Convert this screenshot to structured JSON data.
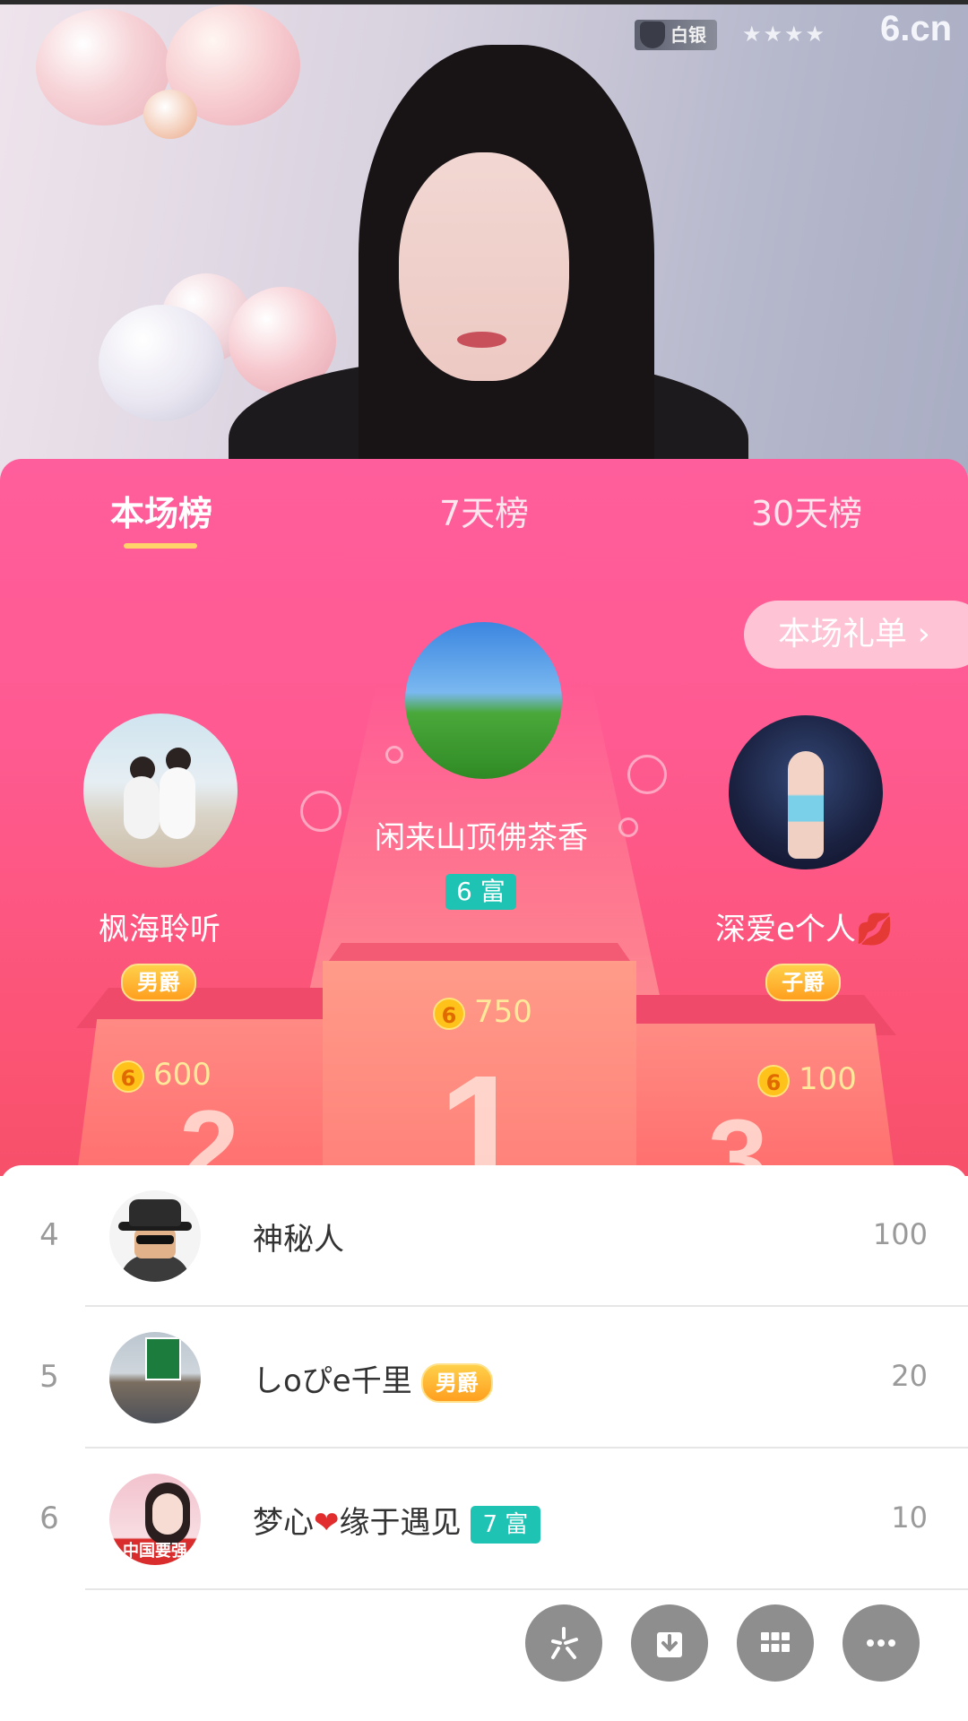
{
  "video": {
    "level_badge": "白银",
    "stars": "★★★★",
    "site_logo": "6.cn"
  },
  "tabs": [
    {
      "label": "本场榜",
      "active": true
    },
    {
      "label": "7天榜",
      "active": false
    },
    {
      "label": "30天榜",
      "active": false
    }
  ],
  "gift_list_button": "本场礼单 ›",
  "podium": {
    "first": {
      "name": "闲来山顶佛茶香",
      "badge": "6 富",
      "coin_icon": "6",
      "amount": "750"
    },
    "second": {
      "name": "枫海聆听",
      "badge": "男爵",
      "coin_icon": "6",
      "amount": "600",
      "podium_number": "2"
    },
    "third": {
      "name": "深爱e个人💋",
      "badge": "子爵",
      "coin_icon": "6",
      "amount": "100",
      "podium_number": "3"
    },
    "center_number": "1"
  },
  "list": [
    {
      "rank": "4",
      "name": "神秘人",
      "score": "100"
    },
    {
      "rank": "5",
      "name": "しoぴe千里",
      "badge": "男爵",
      "score": "20"
    },
    {
      "rank": "6",
      "name_a": "梦心",
      "heart": "❤",
      "name_b": "缘于遇见",
      "badge": "7 富",
      "score": "10",
      "avatar_text": "中国要强"
    }
  ],
  "colors": {
    "panel_pink": "#ff5a91",
    "tab_underline": "#ffd36a",
    "rich_badge": "#1fc3b4",
    "noble_badge": "#ffb330",
    "fab_gray": "#8e8e8e"
  },
  "fab_icons": [
    "share-icon",
    "download-icon",
    "grid-icon",
    "more-icon"
  ]
}
